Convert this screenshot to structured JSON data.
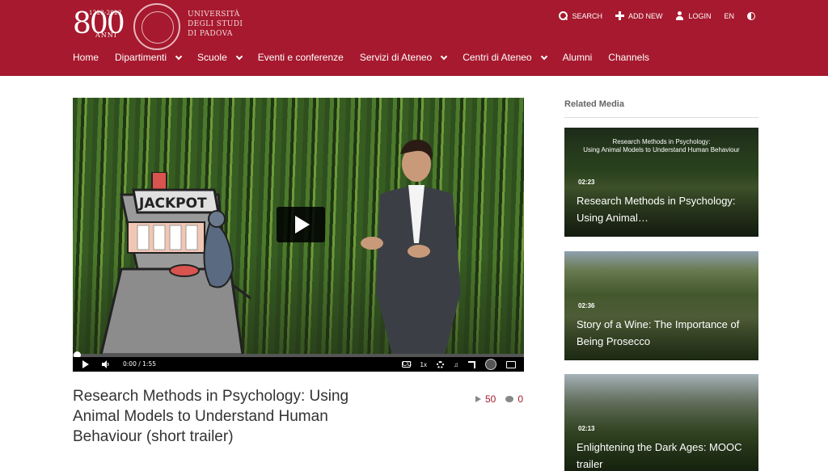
{
  "header": {
    "logo_years": "1222-2022",
    "logo_number": "800",
    "logo_anni": "ANNI",
    "university_line1": "UNIVERSITÀ",
    "university_line2": "DEGLI STUDI",
    "university_line3": "DI PADOVA",
    "top_links": {
      "search": "SEARCH",
      "add_new": "ADD NEW",
      "login": "LOGIN",
      "language": "EN"
    },
    "nav": [
      {
        "label": "Home"
      },
      {
        "label": "Dipartimenti"
      },
      {
        "label": "Scuole"
      },
      {
        "label": "Eventi e conferenze"
      },
      {
        "label": "Servizi di Ateneo"
      },
      {
        "label": "Centri di Ateneo"
      },
      {
        "label": "Alumni"
      },
      {
        "label": "Channels"
      }
    ]
  },
  "player": {
    "current_time": "0:00",
    "duration": "/ 1:55",
    "speed": "1x",
    "progress": 0,
    "machine_label": "JACKPOT"
  },
  "media": {
    "title": "Research Methods in Psychology: Using Animal Models to Understand Human Behaviour (short trailer)",
    "plays": "50",
    "comments": "0"
  },
  "related": {
    "heading": "Related Media",
    "items": [
      {
        "overlay_line1": "Research Methods in Psychology:",
        "overlay_line2": "Using Animal Models to Understand Human Behaviour",
        "duration": "02:23",
        "title": "Research Methods in Psychology: Using Animal…"
      },
      {
        "duration": "02:36",
        "title": "Story of a Wine: The Importance of Being Prosecco"
      },
      {
        "duration": "02:13",
        "title": "Enlightening the Dark Ages: MOOC trailer"
      }
    ]
  },
  "colors": {
    "brand": "#a6192e",
    "stat_accent": "#a6192e"
  }
}
